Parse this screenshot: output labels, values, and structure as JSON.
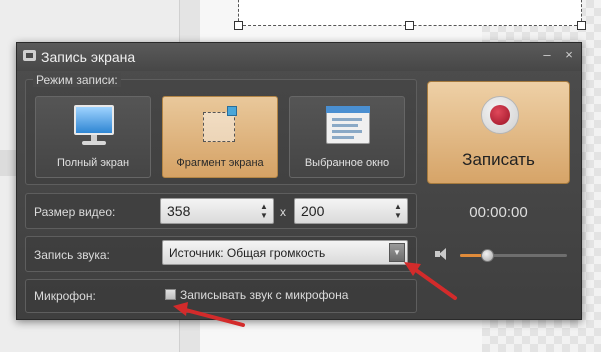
{
  "window": {
    "title": "Запись экрана",
    "minimize_glyph": "–",
    "close_glyph": "×"
  },
  "mode": {
    "section_label": "Режим записи:",
    "buttons": [
      {
        "label": "Полный экран",
        "icon": "monitor-icon",
        "active": false
      },
      {
        "label": "Фрагмент экрана",
        "icon": "fragment-icon",
        "active": true
      },
      {
        "label": "Выбранное окно",
        "icon": "window-icon",
        "active": false
      }
    ]
  },
  "record": {
    "label": "Записать",
    "timer": "00:00:00"
  },
  "video_size": {
    "label": "Размер видео:",
    "width": "358",
    "separator": "x",
    "height": "200"
  },
  "audio": {
    "label": "Запись звука:",
    "source": "Источник: Общая громкость",
    "volume_fraction": 0.25
  },
  "microphone": {
    "label": "Микрофон:",
    "checkbox_label": "Записывать звук с микрофона",
    "checked": false
  },
  "colors": {
    "accent": "#d6a468",
    "window_bg": "#454545",
    "annotation_arrow": "#d32b2b"
  }
}
